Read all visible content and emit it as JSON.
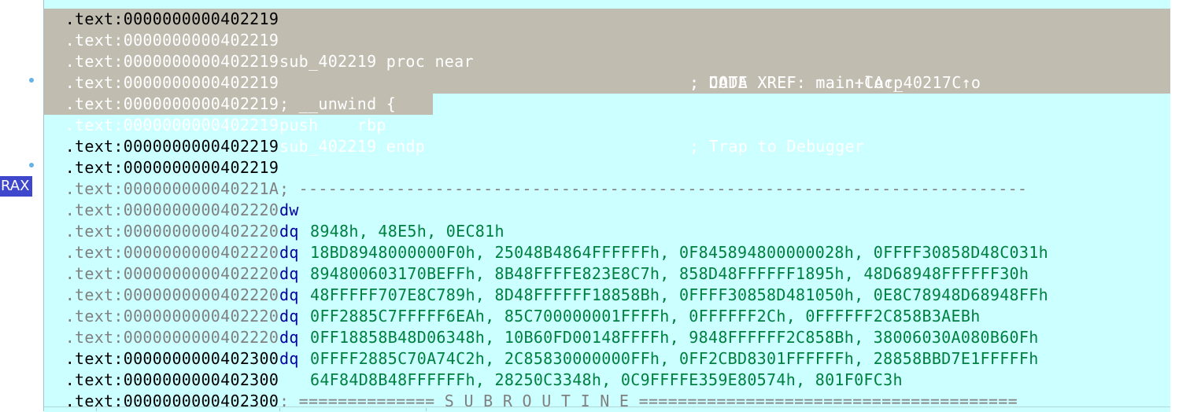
{
  "gutter": {
    "register_badge": "RAX"
  },
  "lines": [
    {
      "addr": ".text:0000000000402219",
      "code": "",
      "comment": ""
    },
    {
      "addr": ".text:0000000000402219",
      "code": "sub_402219 proc near",
      "comment": "; CODE XREF: main+CA↑p"
    },
    {
      "addr": ".text:0000000000402219",
      "code": "",
      "comment": "; DATA XREF: main:loc_40217C↑o"
    },
    {
      "addr": ".text:0000000000402219",
      "code": "; __unwind {",
      "comment": ""
    },
    {
      "addr": ".text:0000000000402219",
      "code": "push    rbp",
      "comment": "; Trap to Debugger"
    },
    {
      "addr": ".text:0000000000402219",
      "code": "sub_402219 endp",
      "comment": ""
    },
    {
      "addr": ".text:0000000000402219",
      "code": "",
      "comment": ""
    },
    {
      "addr": ".text:0000000000402219",
      "code": "; ---------------------------------------------------------------------------",
      "comment": ""
    },
    {
      "addr": ".text:000000000040221A",
      "mnem": "dw",
      "operands": "8948h, 48E5h, 0EC81h"
    },
    {
      "addr": ".text:0000000000402220",
      "mnem": "dq",
      "operands": "18BD8948000000F0h, 25048B4864FFFFFFh, 0F845894800000028h, 0FFFF30858D48C031h"
    },
    {
      "addr": ".text:0000000000402220",
      "mnem": "dq",
      "operands": "894800603170BEFFh, 8B48FFFFE823E8C7h, 858D48FFFFFF1895h, 48D68948FFFFFF30h"
    },
    {
      "addr": ".text:0000000000402220",
      "mnem": "dq",
      "operands": "48FFFFF707E8C789h, 8D48FFFFFF18858Bh, 0FFFF30858D481050h, 0E8C78948D68948FFh"
    },
    {
      "addr": ".text:0000000000402220",
      "mnem": "dq",
      "operands": "0FF2885C7FFFFF6EAh, 85C700000001FFFFh, 0FFFFFF2Ch, 0FFFFFF2C858B3AEBh"
    },
    {
      "addr": ".text:0000000000402220",
      "mnem": "dq",
      "operands": "0FF18858B48D06348h, 10B60FD00148FFFFh, 9848FFFFFF2C858Bh, 38006030A080B60Fh"
    },
    {
      "addr": ".text:0000000000402220",
      "mnem": "dq",
      "operands": "0FFFF2885C70A74C2h, 2C85830000000FFh, 0FF2CBD8301FFFFFFh, 28858BBD7E1FFFFFh"
    },
    {
      "addr": ".text:0000000000402220",
      "mnem": "dq",
      "operands": "64F84D8B48FFFFFFh, 28250C3348h, 0C9FFFFE359E80574h, 801F0FC3h"
    },
    {
      "addr": ".text:0000000000402300",
      "code": "",
      "comment": ""
    },
    {
      "addr": ".text:0000000000402300",
      "code": "; ============== S U B R O U T I N E =======================================",
      "comment": ""
    },
    {
      "addr": ".text:0000000000402300",
      "code": "",
      "comment": ""
    }
  ]
}
